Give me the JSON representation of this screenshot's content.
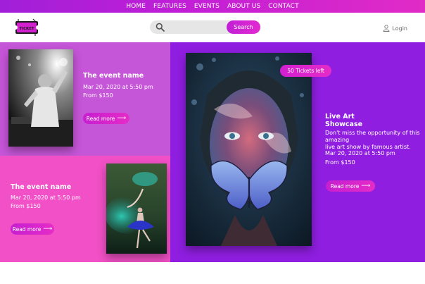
{
  "nav": {
    "items": [
      "HOME",
      "FEATURES",
      "EVENTS",
      "ABOUT US",
      "CONTACT"
    ]
  },
  "header": {
    "logo_text": "TICKET",
    "search_button": "Search",
    "search_placeholder": "",
    "login_label": "Login"
  },
  "events": [
    {
      "title": "The event name",
      "date": "Mar 20, 2020 at 5:50 pm",
      "price": "From $150",
      "cta": "Read more",
      "image": "dj-performer-photo"
    },
    {
      "title": "The event name",
      "date": "Mar 20, 2020 at 5:50 pm",
      "price": "From $150",
      "cta": "Read more",
      "image": "dancer-photo"
    }
  ],
  "featured": {
    "badge": "50 Tickets left",
    "title_line1": "Live Art",
    "title_line2": "Showcase",
    "desc_line1": "Don't miss the opportunity of this",
    "desc_line2": "amazing",
    "desc_line3": "live art show by famous artist.",
    "date": "Mar 20, 2020 at 5:50 pm",
    "price": "From $150",
    "cta": "Read more",
    "image": "painted-face-butterfly-photo"
  },
  "colors": {
    "nav_gradient_start": "#a11fd8",
    "nav_gradient_end": "#e12bc6",
    "panel_purple_light": "#c656d8",
    "panel_pink": "#f250c6",
    "panel_purple_dark": "#8f1ee0",
    "accent_button": "#d424cd"
  }
}
